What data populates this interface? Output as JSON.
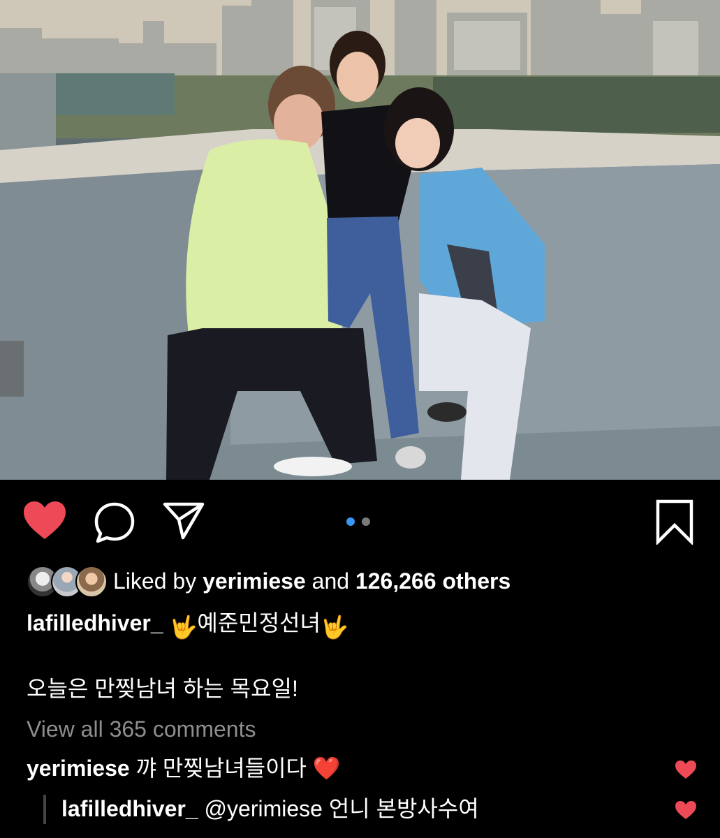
{
  "post": {
    "photo_alt": "",
    "carousel": {
      "current": 1,
      "total": 2
    }
  },
  "colors": {
    "like_red": "#ed4956",
    "pager_active": "#3897f0",
    "pager_inactive": "#7a7a7a",
    "muted_text": "#8e8e8e"
  },
  "actions": {
    "like_icon": "heart-filled-icon",
    "comment_icon": "comment-bubble-icon",
    "share_icon": "paper-plane-icon",
    "save_icon": "bookmark-icon"
  },
  "likes": {
    "prefix": "Liked by ",
    "user": "yerimiese",
    "middle": " and ",
    "count": "126,266 others"
  },
  "caption": {
    "username": "lafilledhiver_",
    "emoji_left": "🤟",
    "text": "예준민정선녀",
    "emoji_right": "🤟",
    "body": "오늘은 만찢남녀 하는 목요일!"
  },
  "comments_link": "View all 365 comments",
  "comments": [
    {
      "username": "yerimiese",
      "text": "꺄 만찢남녀들이다",
      "emoji": "❤️"
    },
    {
      "username": "lafilledhiver_",
      "text": "@yerimiese 언니 본방사수여"
    }
  ]
}
